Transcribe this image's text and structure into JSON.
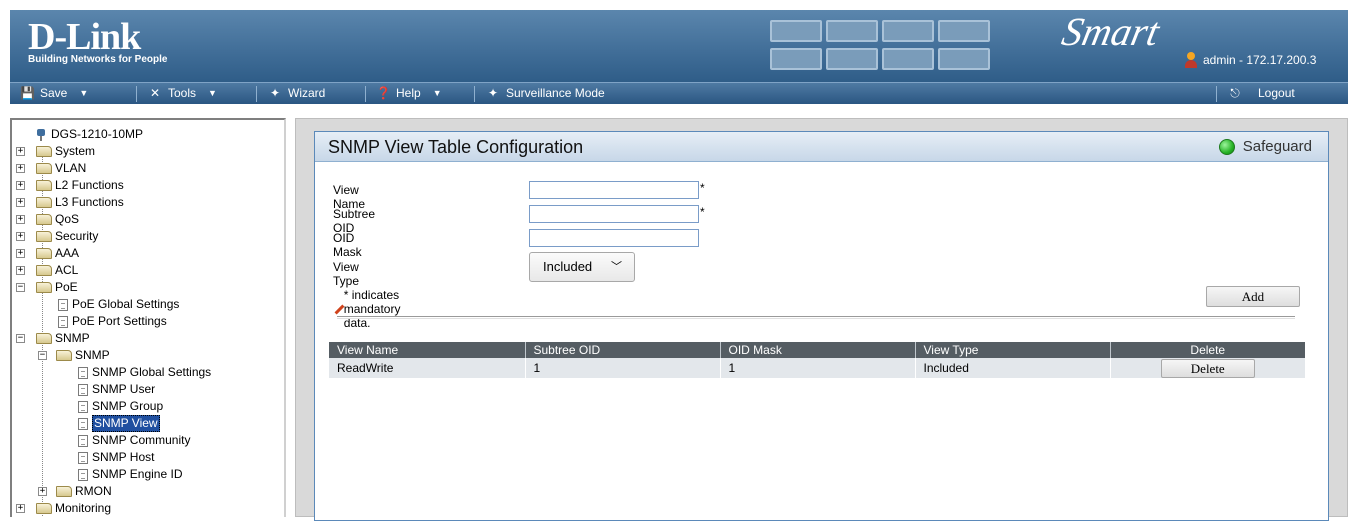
{
  "banner": {
    "brand": "D-Link",
    "tagline": "Building Networks for People",
    "edition": "Smart",
    "user": "admin - 172.17.200.3"
  },
  "menubar": {
    "save": "Save",
    "tools": "Tools",
    "wizard": "Wizard",
    "help": "Help",
    "surveillance": "Surveillance Mode",
    "logout": "Logout"
  },
  "tree": {
    "device": "DGS-1210-10MP",
    "system": "System",
    "vlan": "VLAN",
    "l2": "L2 Functions",
    "l3": "L3 Functions",
    "qos": "QoS",
    "security": "Security",
    "aaa": "AAA",
    "acl": "ACL",
    "poe": "PoE",
    "poe_global": "PoE Global Settings",
    "poe_port": "PoE Port Settings",
    "snmp": "SNMP",
    "snmp_sub": "SNMP",
    "snmp_global": "SNMP Global Settings",
    "snmp_user": "SNMP User",
    "snmp_group": "SNMP Group",
    "snmp_view": "SNMP View",
    "snmp_community": "SNMP Community",
    "snmp_host": "SNMP Host",
    "snmp_engine": "SNMP Engine ID",
    "rmon": "RMON",
    "monitoring": "Monitoring"
  },
  "page": {
    "title": "SNMP View Table Configuration",
    "safeguard": "Safeguard",
    "colors": {
      "safeguard": "#27b327",
      "header_row": "#555d63",
      "selected": "#1f4fa0"
    }
  },
  "form": {
    "view_name_label": "View Name",
    "view_name_value": "",
    "subtree_oid_label": "Subtree OID",
    "subtree_oid_value": "",
    "oid_mask_label": "OID Mask",
    "oid_mask_value": "",
    "view_type_label": "View Type",
    "view_type_value": "Included",
    "mandatory_star": "*",
    "note": "* indicates mandatory data.",
    "add_label": "Add"
  },
  "table": {
    "headers": [
      "View Name",
      "Subtree OID",
      "OID Mask",
      "View Type",
      "Delete"
    ],
    "rows": [
      {
        "view_name": "ReadWrite",
        "subtree_oid": "1",
        "oid_mask": "1",
        "view_type": "Included",
        "delete_label": "Delete"
      }
    ]
  }
}
